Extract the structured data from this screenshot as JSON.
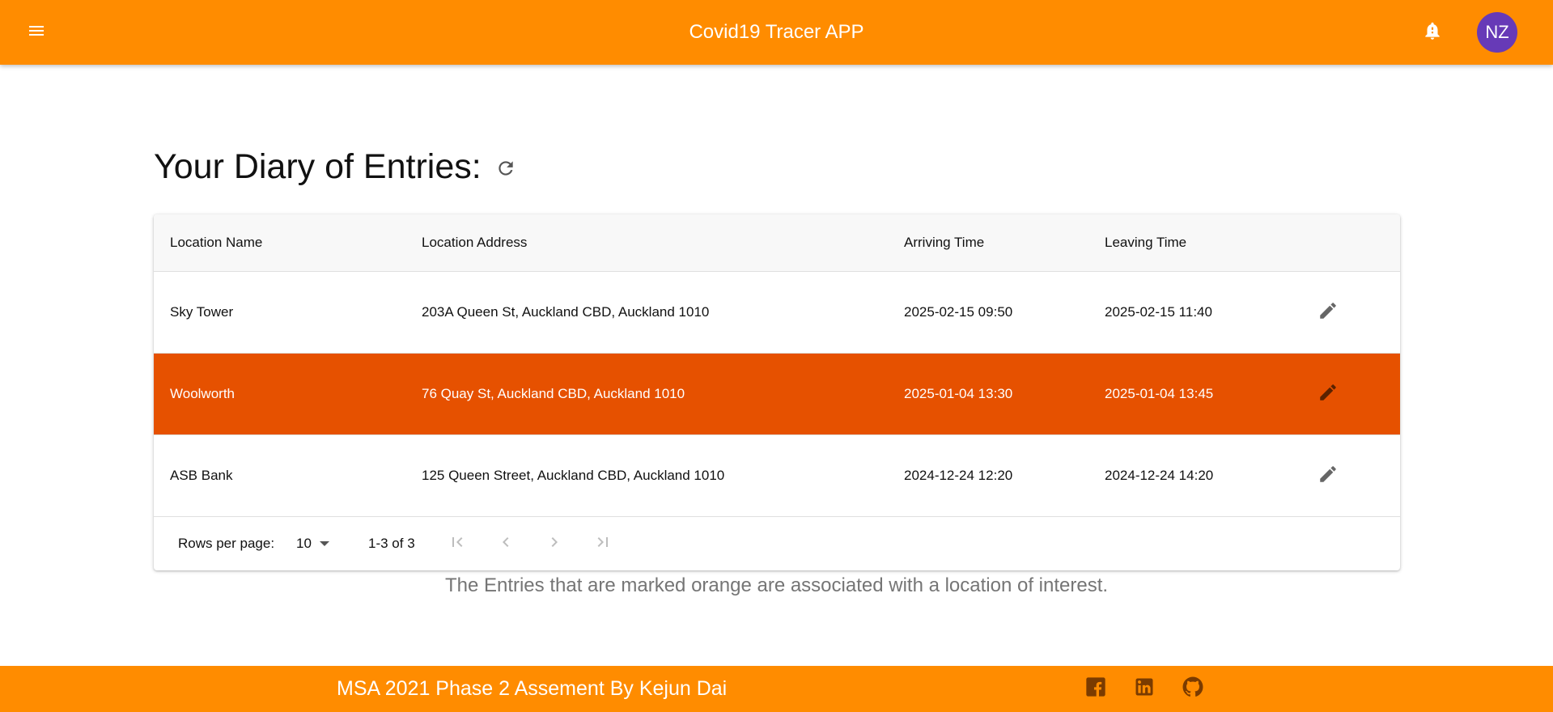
{
  "header": {
    "title": "Covid19 Tracer APP",
    "menu_icon": "menu-icon",
    "notifications_icon": "bell-icon",
    "avatar_initials": "NZ",
    "bar_color": "#ff8c00",
    "avatar_color": "#673ab7"
  },
  "main": {
    "title": "Your Diary of Entries:",
    "refresh_icon": "refresh-icon"
  },
  "table": {
    "columns": [
      "Location Name",
      "Location Address",
      "Arriving Time",
      "Leaving Time"
    ],
    "rows": [
      {
        "name": "Sky Tower",
        "address": "203A Queen St, Auckland CBD, Auckland 1010",
        "arriving": "2025-02-15 09:50",
        "leaving": "2025-02-15 11:40",
        "location_of_interest": false
      },
      {
        "name": "Woolworth",
        "address": "76 Quay St, Auckland CBD, Auckland 1010",
        "arriving": "2025-01-04 13:30",
        "leaving": "2025-01-04 13:45",
        "location_of_interest": true
      },
      {
        "name": "ASB Bank",
        "address": "125 Queen Street, Auckland CBD, Auckland 1010",
        "arriving": "2024-12-24 12:20",
        "leaving": "2024-12-24 14:20",
        "location_of_interest": false
      }
    ],
    "edit_icon": "pencil-icon",
    "highlight_color": "#e65100"
  },
  "pagination": {
    "rows_per_page_label": "Rows per page:",
    "rows_per_page_value": "10",
    "range_label": "1-3 of 3",
    "icons": [
      "first-page-icon",
      "previous-page-icon",
      "next-page-icon",
      "last-page-icon"
    ]
  },
  "note": "The Entries that are marked orange are associated with a location of interest.",
  "footer": {
    "text": "MSA 2021 Phase 2 Assement By Kejun Dai",
    "icons": [
      "facebook-icon",
      "linkedin-icon",
      "github-icon"
    ]
  }
}
